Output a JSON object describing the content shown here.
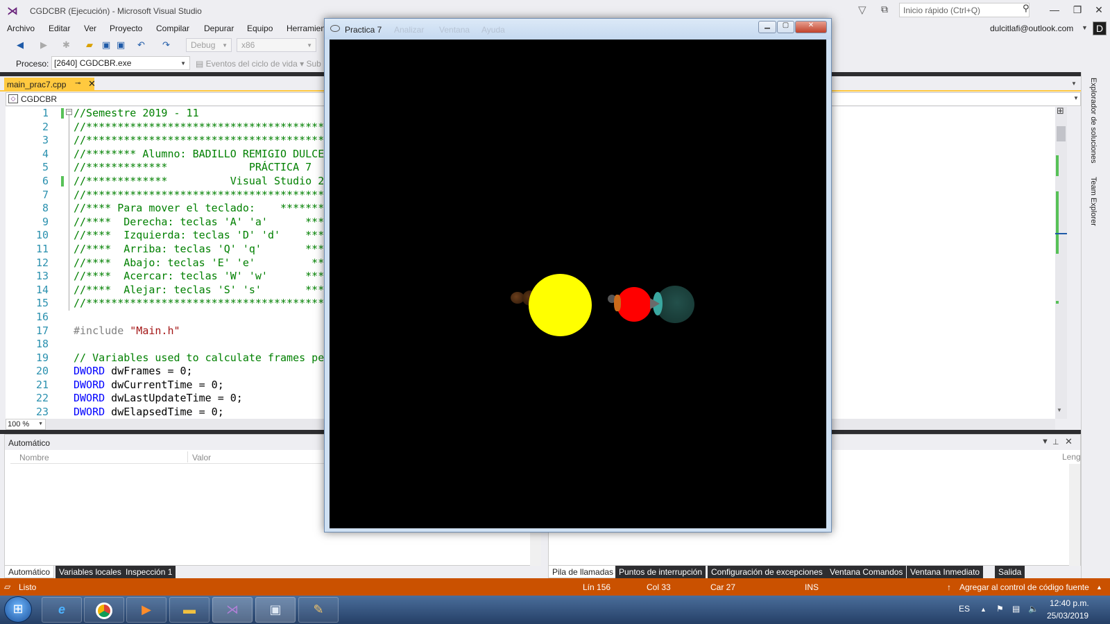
{
  "vs": {
    "title": "CGDCBR (Ejecución) - Microsoft Visual Studio",
    "quick_launch_placeholder": "Inicio rápido (Ctrl+Q)",
    "menu": [
      "Archivo",
      "Editar",
      "Ver",
      "Proyecto",
      "Compilar",
      "Depurar",
      "Equipo",
      "Herramien"
    ],
    "account": "dulcitlafi@outlook.com",
    "avatar_letter": "D",
    "toolbar": {
      "config": "Debug",
      "platform": "x86",
      "process_label": "Proceso:",
      "process_value": "[2640] CGDCBR.exe",
      "lifecycle_events": "Eventos del ciclo de vida",
      "sub_truncated": "Sub"
    },
    "editor": {
      "tab_name": "main_prac7.cpp",
      "nav_scope": "CGDCBR",
      "zoom": "100 %",
      "line_numbers": [
        "1",
        "2",
        "3",
        "4",
        "5",
        "6",
        "7",
        "8",
        "9",
        "10",
        "11",
        "12",
        "13",
        "14",
        "15",
        "16",
        "17",
        "18",
        "19",
        "20",
        "21",
        "22",
        "23"
      ],
      "lines": [
        [
          {
            "t": "//Semestre 2019 - 11",
            "c": "green"
          }
        ],
        [
          {
            "t": "//******************************************",
            "c": "green"
          }
        ],
        [
          {
            "t": "//******************************************",
            "c": "green"
          }
        ],
        [
          {
            "t": "//******** Alumno: BADILLO REMIGIO DULCE",
            "c": "green"
          }
        ],
        [
          {
            "t": "//*************             PRÁCTICA 7",
            "c": "green"
          }
        ],
        [
          {
            "t": "//*************          Visual Studio 20",
            "c": "green"
          }
        ],
        [
          {
            "t": "//******************************************",
            "c": "green"
          }
        ],
        [
          {
            "t": "//**** Para mover el teclado:    *******",
            "c": "green"
          }
        ],
        [
          {
            "t": "//****  Derecha: teclas 'A' 'a'      ***",
            "c": "green"
          }
        ],
        [
          {
            "t": "//****  Izquierda: teclas 'D' 'd'    ***",
            "c": "green"
          }
        ],
        [
          {
            "t": "//****  Arriba: teclas 'Q' 'q'       ***",
            "c": "green"
          }
        ],
        [
          {
            "t": "//****  Abajo: teclas 'E' 'e'         **",
            "c": "green"
          }
        ],
        [
          {
            "t": "//****  Acercar: teclas 'W' 'w'      ***",
            "c": "green"
          }
        ],
        [
          {
            "t": "//****  Alejar: teclas 'S' 's'       ***",
            "c": "green"
          }
        ],
        [
          {
            "t": "//******************************************",
            "c": "green"
          }
        ],
        [
          {
            "t": "",
            "c": "black"
          }
        ],
        [
          {
            "t": "#include ",
            "c": "gray"
          },
          {
            "t": "\"Main.h\"",
            "c": "red"
          }
        ],
        [
          {
            "t": "",
            "c": "black"
          }
        ],
        [
          {
            "t": "// Variables used to calculate frames pe",
            "c": "green"
          }
        ],
        [
          {
            "t": "DWORD",
            "c": "blue"
          },
          {
            "t": " dwFrames = 0;",
            "c": "black"
          }
        ],
        [
          {
            "t": "DWORD",
            "c": "blue"
          },
          {
            "t": " dwCurrentTime = 0;",
            "c": "black"
          }
        ],
        [
          {
            "t": "DWORD",
            "c": "blue"
          },
          {
            "t": " dwLastUpdateTime = 0;",
            "c": "black"
          }
        ],
        [
          {
            "t": "DWORD",
            "c": "blue"
          },
          {
            "t": " dwElapsedTime = 0;",
            "c": "black"
          }
        ]
      ]
    },
    "right_rail": [
      "Explorador de soluciones",
      "Team Explorer"
    ],
    "auto_pane": {
      "title": "Automático",
      "col_name": "Nombre",
      "col_value": "Valor",
      "col_lang": "Leng"
    },
    "bottom_tabs_left": [
      "Automático",
      "Variables locales",
      "Inspección 1"
    ],
    "bottom_tabs_right": [
      "Pila de llamadas",
      "Puntos de interrupción",
      "Configuración de excepciones",
      "Ventana Comandos",
      "Ventana Inmediato",
      "Salida"
    ],
    "status": {
      "ready": "Listo",
      "line": "Lín 156",
      "col": "Col 33",
      "char": "Car 27",
      "mode": "INS",
      "source_control": "Agregar al control de código fuente"
    }
  },
  "gl_window": {
    "title": "Practica 7",
    "ghost_menu": [
      "Analizar",
      "Ventana",
      "Ayuda"
    ],
    "colors": {
      "sun": "#ffff00",
      "red_planet": "#ff0000",
      "teal_planet": "#1f4a46",
      "brown_moon": "#4a2a12",
      "gray_moon": "#555555"
    }
  },
  "taskbar": {
    "lang": "ES",
    "time": "12:40 p.m.",
    "date": "25/03/2019",
    "apps": [
      "internet-explorer-icon",
      "chrome-icon",
      "media-player-icon",
      "file-explorer-icon",
      "visual-studio-icon",
      "opengl-app-icon",
      "paint-icon"
    ]
  }
}
